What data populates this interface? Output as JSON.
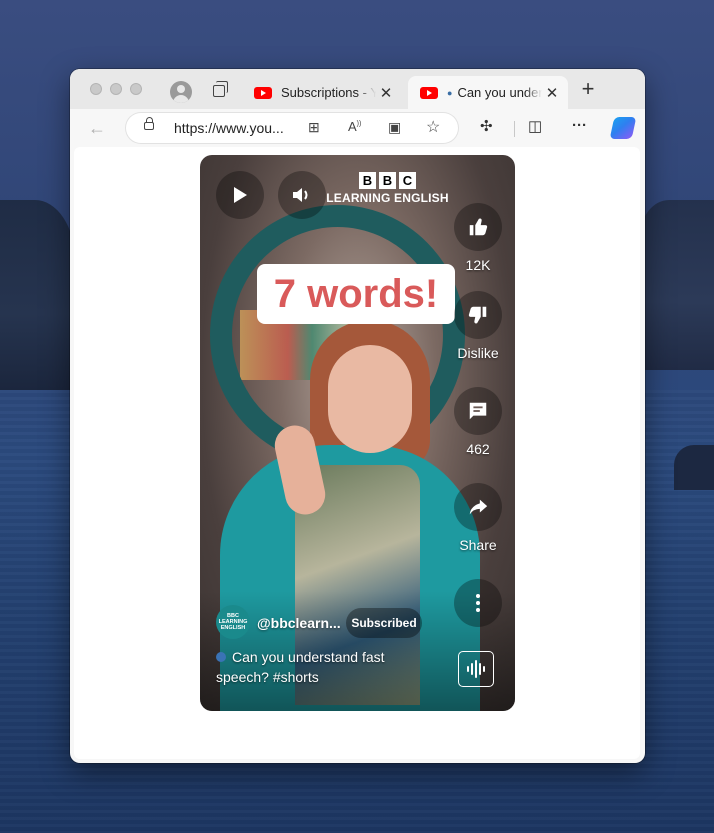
{
  "browser": {
    "tabs": [
      {
        "title": "Subscriptions - YouTube",
        "active": false
      },
      {
        "title": "Can you understand fast speech? #shorts",
        "active": true
      }
    ],
    "url": "https://www.you...",
    "new_tab_glyph": "+",
    "close_glyph": "✕",
    "icons": [
      "back-arrow-icon",
      "lock-icon",
      "app-grid-icon",
      "read-aloud-icon",
      "add-to-video-icon",
      "star-icon",
      "extensions-icon",
      "split-screen-icon",
      "more-icon",
      "copilot-icon"
    ]
  },
  "short": {
    "bbc_logo": {
      "letters": [
        "B",
        "B",
        "C"
      ],
      "subtitle": "LEARNING ENGLISH"
    },
    "overlay_text": "7 words!",
    "like_count": "12K",
    "dislike_label": "Dislike",
    "comment_count": "462",
    "share_label": "Share",
    "channel_handle": "@bbclearn...",
    "channel_avatar_text": [
      "BBC",
      "LEARNING",
      "ENGLISH"
    ],
    "subscribe_label": "Subscribed",
    "caption": "Can you understand fast speech? #shorts"
  },
  "colors": {
    "accent_red": "#ff0000",
    "headline_red": "#d95a5a",
    "teal": "#1a8a8c"
  }
}
